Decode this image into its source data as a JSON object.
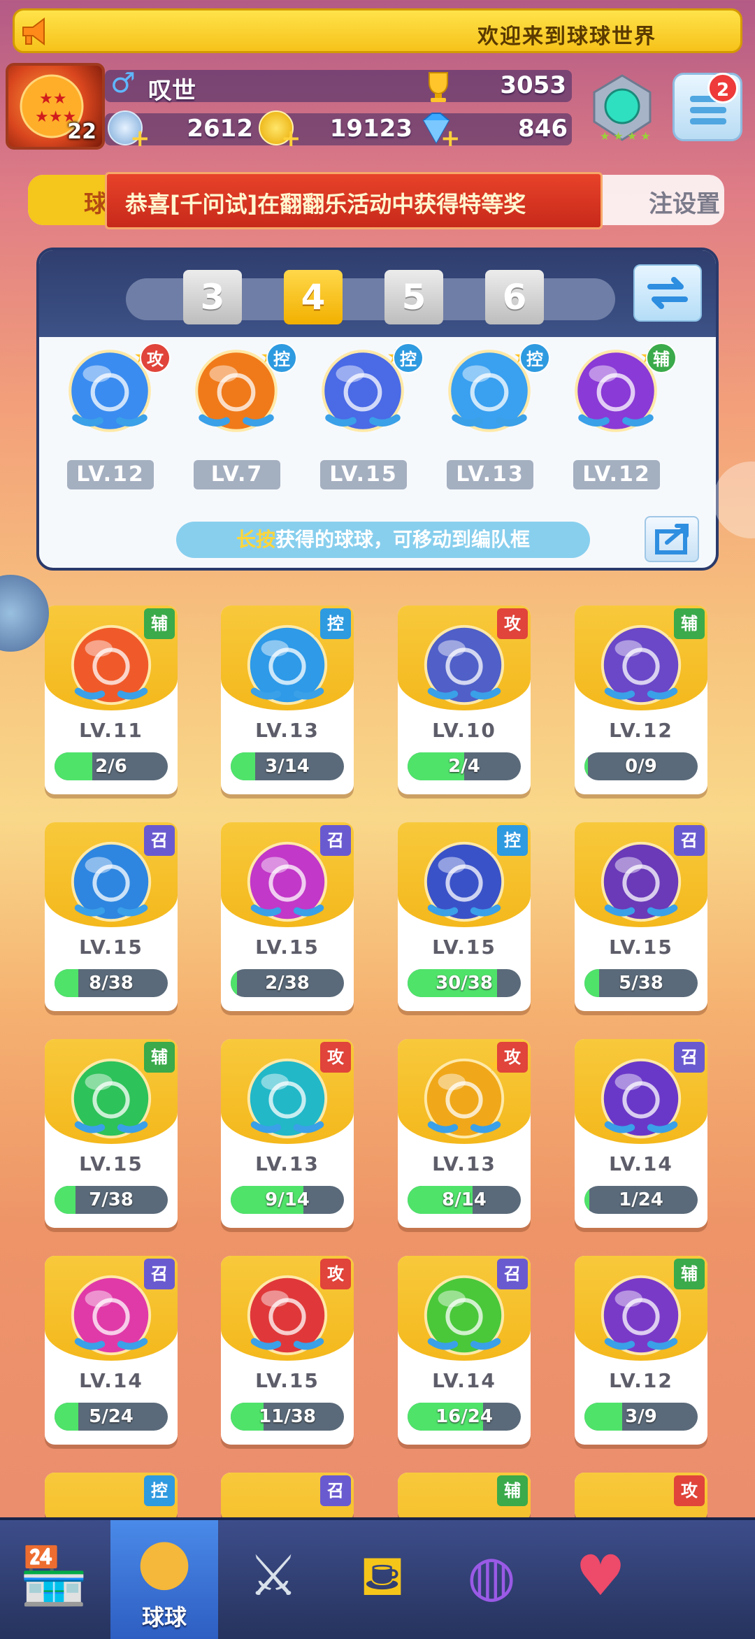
{
  "banner": {
    "message": "欢迎来到球球世界"
  },
  "player": {
    "name": "叹世",
    "level": "22",
    "gender_symbol": "♂",
    "trophies": "3053",
    "energy": "2612",
    "coins": "19123",
    "gems": "846"
  },
  "menu": {
    "badge_count": "2"
  },
  "tabs": {
    "left_label": "球",
    "right_label": "注设置"
  },
  "announcement": "恭喜[千问试]在翻翻乐活动中获得特等奖",
  "team": {
    "page_tabs": [
      "3",
      "4",
      "5",
      "6"
    ],
    "active_page": "4",
    "balls": [
      {
        "tag": "攻",
        "level": "LV.12",
        "color": "#3a8cf0",
        "icon": "swirl-ball-icon"
      },
      {
        "tag": "控",
        "level": "LV.7",
        "color": "#f07a1a",
        "icon": "star-ball-icon"
      },
      {
        "tag": "控",
        "level": "LV.15",
        "color": "#4a6ae6",
        "icon": "moon-ball-icon"
      },
      {
        "tag": "控",
        "level": "LV.13",
        "color": "#3aa0f0",
        "icon": "cloud-ball-icon"
      },
      {
        "tag": "辅",
        "level": "LV.12",
        "color": "#8a3ad6",
        "icon": "leaf-ball-icon"
      }
    ],
    "hint_highlight": "长按",
    "hint_text": "获得的球球，可移动到编队框"
  },
  "collection": [
    {
      "tag": "辅",
      "level": "LV.11",
      "progress": "2/6",
      "fraction": 0.333,
      "color": "#f05a2a",
      "icon": "wings-ball-icon"
    },
    {
      "tag": "控",
      "level": "LV.13",
      "progress": "3/14",
      "fraction": 0.214,
      "color": "#2e9ae8",
      "icon": "cloud-ball-icon"
    },
    {
      "tag": "攻",
      "level": "LV.10",
      "progress": "2/4",
      "fraction": 0.5,
      "color": "#5060c8",
      "icon": "pixel-ball-icon"
    },
    {
      "tag": "辅",
      "level": "LV.12",
      "progress": "0/9",
      "fraction": 0.0,
      "color": "#6a48c8",
      "icon": "crowd-ball-icon"
    },
    {
      "tag": "召",
      "level": "LV.15",
      "progress": "8/38",
      "fraction": 0.21,
      "color": "#2e86e0",
      "icon": "vortex-ball-icon"
    },
    {
      "tag": "召",
      "level": "LV.15",
      "progress": "2/38",
      "fraction": 0.053,
      "color": "#c238c8",
      "icon": "mushroom-ball-icon"
    },
    {
      "tag": "控",
      "level": "LV.15",
      "progress": "30/38",
      "fraction": 0.789,
      "color": "#3a52c8",
      "icon": "moon-ball-icon"
    },
    {
      "tag": "召",
      "level": "LV.15",
      "progress": "5/38",
      "fraction": 0.132,
      "color": "#6a3ab8",
      "icon": "ghost-ball-icon"
    },
    {
      "tag": "辅",
      "level": "LV.15",
      "progress": "7/38",
      "fraction": 0.184,
      "color": "#2ec25a",
      "icon": "arrow-ball-icon"
    },
    {
      "tag": "攻",
      "level": "LV.13",
      "progress": "9/14",
      "fraction": 0.643,
      "color": "#22b8c8",
      "icon": "tornado-ball-icon"
    },
    {
      "tag": "攻",
      "level": "LV.13",
      "progress": "8/14",
      "fraction": 0.571,
      "color": "#f0a81a",
      "icon": "shuriken-ball-icon"
    },
    {
      "tag": "召",
      "level": "LV.14",
      "progress": "1/24",
      "fraction": 0.042,
      "color": "#6a38c8",
      "icon": "planet-ball-icon"
    },
    {
      "tag": "召",
      "level": "LV.14",
      "progress": "5/24",
      "fraction": 0.208,
      "color": "#e03aa8",
      "icon": "blade-ball-icon"
    },
    {
      "tag": "攻",
      "level": "LV.15",
      "progress": "11/38",
      "fraction": 0.289,
      "color": "#e0383a",
      "icon": "fist-ball-icon"
    },
    {
      "tag": "召",
      "level": "LV.14",
      "progress": "16/24",
      "fraction": 0.667,
      "color": "#4ac83a",
      "icon": "seal-ball-icon"
    },
    {
      "tag": "辅",
      "level": "LV.12",
      "progress": "3/9",
      "fraction": 0.333,
      "color": "#7a3ac8",
      "icon": "leaf-ball-icon"
    }
  ],
  "partial_row_tags": [
    "控",
    "召",
    "辅",
    "攻"
  ],
  "tag_colors": {
    "攻": "#e0443a",
    "控": "#2e9ae0",
    "辅": "#3aaa4a",
    "召": "#6a5ad0"
  },
  "nav": [
    {
      "label": "",
      "icon": "shop-icon"
    },
    {
      "label": "球球",
      "icon": "balls-icon",
      "active": true
    },
    {
      "label": "",
      "icon": "crossed-swords-icon"
    },
    {
      "label": "",
      "icon": "whistle-icon"
    },
    {
      "label": "",
      "icon": "planet-icon"
    },
    {
      "label": "",
      "icon": "chat-heart-icon"
    }
  ]
}
